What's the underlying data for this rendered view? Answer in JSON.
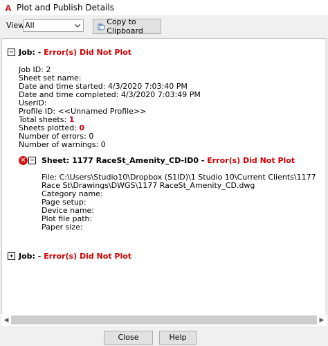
{
  "window": {
    "title": "Plot and Publish Details"
  },
  "toolbar": {
    "view_label": "View:",
    "view_value": "All",
    "copy_label": "Copy to Clipboard"
  },
  "jobs": [
    {
      "toggle": "−",
      "label": "Job: -",
      "status": "Error(s) Did Not Plot",
      "details": [
        "Job ID: 2",
        "Sheet set name:",
        "Date and time started: 4/3/2020 7:03:40 PM",
        "Date and time completed: 4/3/2020 7:03:49 PM",
        "UserID:",
        "Profile ID: <<Unnamed Profile>>"
      ],
      "total_sheets_label": "Total sheets:",
      "total_sheets_value": "1",
      "sheets_plotted_label": "Sheets plotted:",
      "sheets_plotted_value": "0",
      "errors": "Number of errors: 0",
      "warnings": "Number of warnings: 0",
      "sheet": {
        "toggle": "−",
        "label": "Sheet: 1177 RaceSt_Amenity_CD-ID0 -",
        "status": "Error(s) Did Not Plot",
        "details": [
          "File: C:\\Users\\Studio10\\Dropbox (S1ID)\\1 Studio 10\\Current Clients\\1177",
          "Race St\\Drawings\\DWGS\\1177 RaceSt_Amenity_CD.dwg",
          "Category name:",
          "Page setup:",
          "Device name:",
          "Plot file path:",
          "Paper size:"
        ]
      }
    },
    {
      "toggle": "+",
      "label": "Job: -",
      "status": "Error(s) Did Not Plot"
    }
  ],
  "buttons": {
    "close": "Close",
    "help": "Help"
  }
}
